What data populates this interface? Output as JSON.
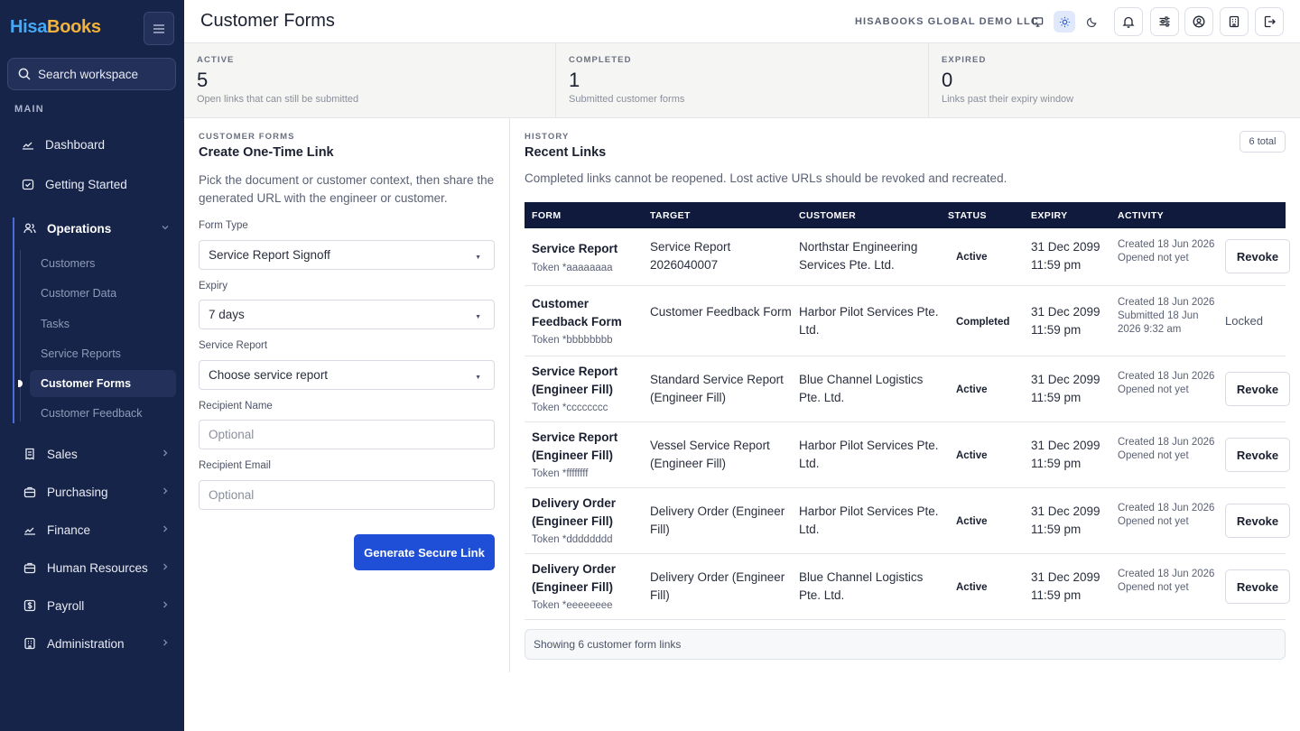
{
  "brand": {
    "name_part1": "Hisa",
    "name_part2": "Books",
    "color_primary": "#46a8f5",
    "color_accent": "#f2b33d"
  },
  "sidebar": {
    "search_placeholder": "Search workspace",
    "section_label": "MAIN",
    "items": [
      {
        "label": "Dashboard",
        "icon": "chart-line-icon"
      },
      {
        "label": "Getting Started",
        "icon": "calendar-check-icon"
      },
      {
        "label": "Operations",
        "icon": "users-icon",
        "expanded": true
      },
      {
        "label": "Sales",
        "icon": "receipt-icon"
      },
      {
        "label": "Purchasing",
        "icon": "briefcase-icon"
      },
      {
        "label": "Finance",
        "icon": "trend-icon"
      },
      {
        "label": "Human Resources",
        "icon": "briefcase-icon"
      },
      {
        "label": "Payroll",
        "icon": "dollar-icon"
      },
      {
        "label": "Administration",
        "icon": "building-icon"
      }
    ],
    "operations_sub": [
      "Customers",
      "Customer Data",
      "Tasks",
      "Service Reports",
      "Customer Forms",
      "Customer Feedback"
    ],
    "active_sub": "Customer Forms",
    "bg_color": "#172449"
  },
  "header": {
    "title": "Customer Forms",
    "company": "HISABOOKS GLOBAL DEMO LLC",
    "theme_selected": "light"
  },
  "stats": [
    {
      "label": "ACTIVE",
      "value": "5",
      "desc": "Open links that can still be submitted"
    },
    {
      "label": "COMPLETED",
      "value": "1",
      "desc": "Submitted customer forms"
    },
    {
      "label": "EXPIRED",
      "value": "0",
      "desc": "Links past their expiry window"
    }
  ],
  "create": {
    "eyebrow": "CUSTOMER FORMS",
    "title": "Create One-Time Link",
    "desc": "Pick the document or customer context, then share the generated URL with the engineer or customer.",
    "form_type_label": "Form Type",
    "form_type_value": "Service Report Signoff",
    "expiry_label": "Expiry",
    "expiry_value": "7 days",
    "service_report_label": "Service Report",
    "service_report_value": "Choose service report",
    "recipient_name_label": "Recipient Name",
    "recipient_name_placeholder": "Optional",
    "recipient_email_label": "Recipient Email",
    "recipient_email_placeholder": "Optional",
    "submit_label": "Generate Secure Link",
    "button_color": "#1f4fd6"
  },
  "history": {
    "eyebrow": "HISTORY",
    "title": "Recent Links",
    "total_badge": "6 total",
    "desc": "Completed links cannot be reopened. Lost active URLs should be revoked and recreated.",
    "columns": [
      "FORM",
      "TARGET",
      "CUSTOMER",
      "STATUS",
      "EXPIRY",
      "ACTIVITY"
    ],
    "rows": [
      {
        "form": "Service Report",
        "token": "Token *aaaaaaaa",
        "target": "Service Report 2026040007",
        "customer": "Northstar Engineering Services Pte. Ltd.",
        "status": "Active",
        "expiry": "31 Dec 2099 11:59 pm",
        "activity1": "Created 18 Jun 2026",
        "activity2": "Opened not yet",
        "action": "Revoke"
      },
      {
        "form": "Customer Feedback Form",
        "token": "Token *bbbbbbbb",
        "target": "Customer Feedback Form",
        "customer": "Harbor Pilot Services Pte. Ltd.",
        "status": "Completed",
        "expiry": "31 Dec 2099 11:59 pm",
        "activity1": "Created 18 Jun 2026",
        "activity2": "Submitted 18 Jun 2026 9:32 am",
        "action": "Locked"
      },
      {
        "form": "Service Report (Engineer Fill)",
        "token": "Token *cccccccc",
        "target": "Standard Service Report (Engineer Fill)",
        "customer": "Blue Channel Logistics Pte. Ltd.",
        "status": "Active",
        "expiry": "31 Dec 2099 11:59 pm",
        "activity1": "Created 18 Jun 2026",
        "activity2": "Opened not yet",
        "action": "Revoke"
      },
      {
        "form": "Service Report (Engineer Fill)",
        "token": "Token *ffffffff",
        "target": "Vessel Service Report (Engineer Fill)",
        "customer": "Harbor Pilot Services Pte. Ltd.",
        "status": "Active",
        "expiry": "31 Dec 2099 11:59 pm",
        "activity1": "Created 18 Jun 2026",
        "activity2": "Opened not yet",
        "action": "Revoke"
      },
      {
        "form": "Delivery Order (Engineer Fill)",
        "token": "Token *dddddddd",
        "target": "Delivery Order (Engineer Fill)",
        "customer": "Harbor Pilot Services Pte. Ltd.",
        "status": "Active",
        "expiry": "31 Dec 2099 11:59 pm",
        "activity1": "Created 18 Jun 2026",
        "activity2": "Opened not yet",
        "action": "Revoke"
      },
      {
        "form": "Delivery Order (Engineer Fill)",
        "token": "Token *eeeeeeee",
        "target": "Delivery Order (Engineer Fill)",
        "customer": "Blue Channel Logistics Pte. Ltd.",
        "status": "Active",
        "expiry": "31 Dec 2099 11:59 pm",
        "activity1": "Created 18 Jun 2026",
        "activity2": "Opened not yet",
        "action": "Revoke"
      }
    ],
    "footer": "Showing 6 customer form links",
    "header_color": "#0f1a3d"
  }
}
